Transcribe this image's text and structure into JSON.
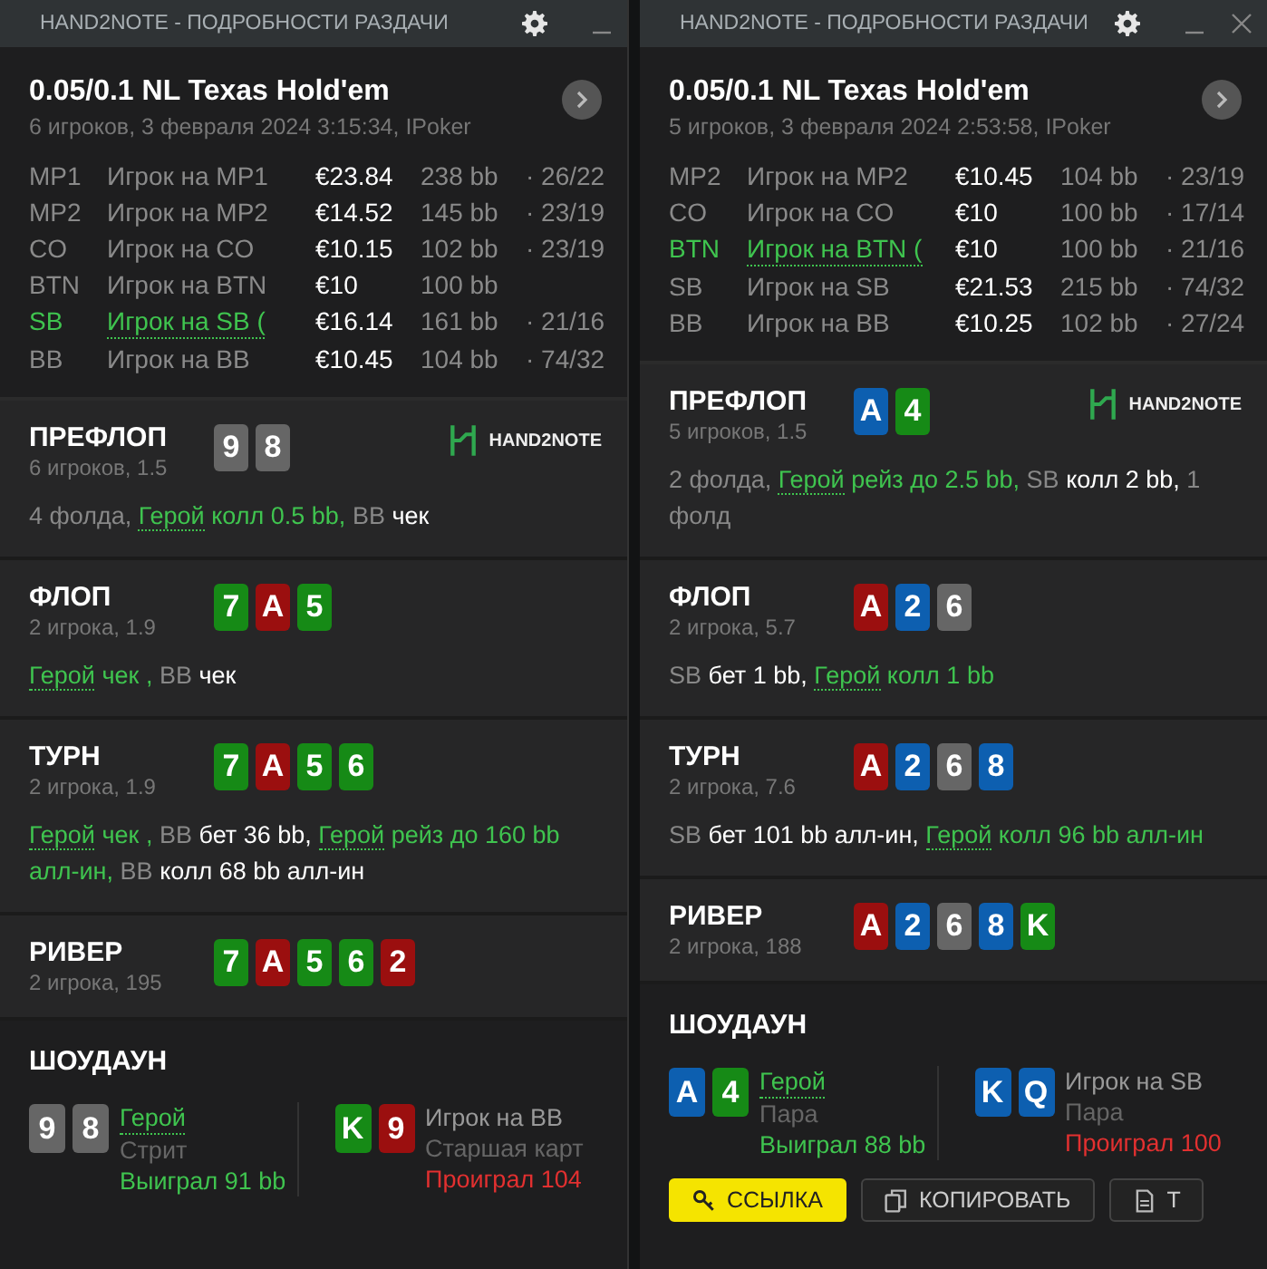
{
  "windows": [
    {
      "title": "HAND2NOTE - ПОДРОБНОСТИ РАЗДАЧИ",
      "close_visible": false,
      "header": {
        "game": "0.05/0.1 NL Texas Hold'em",
        "info": "6 игроков, 3 февраля 2024 3:15:34, IPoker"
      },
      "players": [
        {
          "position": "MP1",
          "name": "Игрок на MP1",
          "stack": "€23.84",
          "bb": "238 bb",
          "stats": "· 26/22",
          "hero": false
        },
        {
          "position": "MP2",
          "name": "Игрок на MP2",
          "stack": "€14.52",
          "bb": "145 bb",
          "stats": "· 23/19",
          "hero": false
        },
        {
          "position": "CO",
          "name": "Игрок на CO",
          "stack": "€10.15",
          "bb": "102 bb",
          "stats": "· 23/19",
          "hero": false
        },
        {
          "position": "BTN",
          "name": "Игрок на BTN",
          "stack": "€10",
          "bb": "100 bb",
          "hero": false
        },
        {
          "position": "SB",
          "name": "Игрок на SB (",
          "stack": "€16.14",
          "bb": "161 bb",
          "stats": "· 21/16",
          "hero": true
        },
        {
          "position": "BB",
          "name": "Игрок на BB",
          "stack": "€10.45",
          "bb": "104 bb",
          "stats": "· 74/32",
          "hero": false
        }
      ],
      "streets": [
        {
          "name": "ПРЕФЛОП",
          "info": "6 игроков, 1.5",
          "logo": "HAND2NOTE",
          "cards": [
            {
              "rank": "9",
              "color": "#666666"
            },
            {
              "rank": "8",
              "color": "#666666"
            }
          ],
          "actions": [
            {
              "text": "4 фолда,",
              "kind": "muted"
            },
            {
              "text": "Герой",
              "kind": "hero"
            },
            {
              "text": "колл 0.5 bb,",
              "kind": "hero_action"
            },
            {
              "text": "BB",
              "kind": "muted"
            },
            {
              "text": "чек",
              "kind": "action"
            }
          ]
        },
        {
          "name": "ФЛОП",
          "info": "2 игрока, 1.9",
          "cards": [
            {
              "rank": "7",
              "color": "#168a16"
            },
            {
              "rank": "A",
              "color": "#9b0f0f"
            },
            {
              "rank": "5",
              "color": "#168a16"
            }
          ],
          "actions": [
            {
              "text": "Герой",
              "kind": "hero"
            },
            {
              "text": "чек ,",
              "kind": "hero_action"
            },
            {
              "text": "BB",
              "kind": "muted"
            },
            {
              "text": "чек",
              "kind": "action"
            }
          ]
        },
        {
          "name": "ТУРН",
          "info": "2 игрока, 1.9",
          "cards": [
            {
              "rank": "7",
              "color": "#168a16"
            },
            {
              "rank": "A",
              "color": "#9b0f0f"
            },
            {
              "rank": "5",
              "color": "#168a16"
            },
            {
              "rank": "6",
              "color": "#168a16"
            }
          ],
          "actions": [
            {
              "text": "Герой",
              "kind": "hero"
            },
            {
              "text": "чек ,",
              "kind": "hero_action"
            },
            {
              "text": "BB",
              "kind": "muted"
            },
            {
              "text": "бет 36 bb,",
              "kind": "action"
            },
            {
              "text": "Герой",
              "kind": "hero"
            },
            {
              "text": "рейз до 160 bb алл-ин,",
              "kind": "hero_action"
            },
            {
              "text": "BB",
              "kind": "muted"
            },
            {
              "text": "колл 68 bb алл-ин",
              "kind": "action"
            }
          ]
        },
        {
          "name": "РИВЕР",
          "info": "2 игрока, 195",
          "cards": [
            {
              "rank": "7",
              "color": "#168a16"
            },
            {
              "rank": "A",
              "color": "#9b0f0f"
            },
            {
              "rank": "5",
              "color": "#168a16"
            },
            {
              "rank": "6",
              "color": "#168a16"
            },
            {
              "rank": "2",
              "color": "#9b0f0f"
            }
          ]
        }
      ],
      "showdown": {
        "title": "ШОУДАУН",
        "hands": [
          {
            "cards": [
              {
                "rank": "9",
                "color": "#666666"
              },
              {
                "rank": "8",
                "color": "#666666"
              }
            ],
            "name": "Герой",
            "hero": true,
            "hand": "Стрит",
            "result": "Выиграл 91 bb",
            "won": true
          },
          {
            "cards": [
              {
                "rank": "K",
                "color": "#168a16"
              },
              {
                "rank": "9",
                "color": "#9b0f0f"
              }
            ],
            "name": "Игрок на BB",
            "hero": false,
            "hand": "Старшая карт",
            "result": "Проиграл 104",
            "won": false
          }
        ]
      }
    },
    {
      "title": "HAND2NOTE - ПОДРОБНОСТИ РАЗДАЧИ",
      "close_visible": true,
      "header": {
        "game": "0.05/0.1 NL Texas Hold'em",
        "info": "5 игроков, 3 февраля 2024 2:53:58, IPoker"
      },
      "players": [
        {
          "position": "MP2",
          "name": "Игрок на MP2",
          "stack": "€10.45",
          "bb": "104 bb",
          "stats": "· 23/19",
          "hero": false
        },
        {
          "position": "CO",
          "name": "Игрок на CO",
          "stack": "€10",
          "bb": "100 bb",
          "stats": "· 17/14",
          "hero": false
        },
        {
          "position": "BTN",
          "name": "Игрок на BTN (",
          "stack": "€10",
          "bb": "100 bb",
          "stats": "· 21/16",
          "hero": true
        },
        {
          "position": "SB",
          "name": "Игрок на SB",
          "stack": "€21.53",
          "bb": "215 bb",
          "stats": "· 74/32",
          "hero": false
        },
        {
          "position": "BB",
          "name": "Игрок на BB",
          "stack": "€10.25",
          "bb": "102 bb",
          "stats": "· 27/24",
          "hero": false
        }
      ],
      "streets": [
        {
          "name": "ПРЕФЛОП",
          "info": "5 игроков, 1.5",
          "logo": "HAND2NOTE",
          "cards": [
            {
              "rank": "A",
              "color": "#0d5fb0"
            },
            {
              "rank": "4",
              "color": "#168a16"
            }
          ],
          "actions": [
            {
              "text": "2 фолда,",
              "kind": "muted"
            },
            {
              "text": "Герой",
              "kind": "hero"
            },
            {
              "text": "рейз до 2.5 bb,",
              "kind": "hero_action"
            },
            {
              "text": "SB",
              "kind": "muted"
            },
            {
              "text": "колл 2 bb,",
              "kind": "action"
            },
            {
              "text": "1 фолд",
              "kind": "muted"
            }
          ]
        },
        {
          "name": "ФЛОП",
          "info": "2 игрока, 5.7",
          "cards": [
            {
              "rank": "A",
              "color": "#9b0f0f"
            },
            {
              "rank": "2",
              "color": "#0d5fb0"
            },
            {
              "rank": "6",
              "color": "#666666"
            }
          ],
          "actions": [
            {
              "text": "SB",
              "kind": "muted"
            },
            {
              "text": "бет 1 bb,",
              "kind": "action"
            },
            {
              "text": "Герой",
              "kind": "hero"
            },
            {
              "text": "колл 1 bb",
              "kind": "hero_action"
            }
          ]
        },
        {
          "name": "ТУРН",
          "info": "2 игрока, 7.6",
          "cards": [
            {
              "rank": "A",
              "color": "#9b0f0f"
            },
            {
              "rank": "2",
              "color": "#0d5fb0"
            },
            {
              "rank": "6",
              "color": "#666666"
            },
            {
              "rank": "8",
              "color": "#0d5fb0"
            }
          ],
          "actions": [
            {
              "text": "SB",
              "kind": "muted"
            },
            {
              "text": "бет 101 bb алл-ин,",
              "kind": "action"
            },
            {
              "text": "Герой",
              "kind": "hero"
            },
            {
              "text": "колл 96 bb алл-ин",
              "kind": "hero_action"
            }
          ]
        },
        {
          "name": "РИВЕР",
          "info": "2 игрока, 188",
          "cards": [
            {
              "rank": "A",
              "color": "#9b0f0f"
            },
            {
              "rank": "2",
              "color": "#0d5fb0"
            },
            {
              "rank": "6",
              "color": "#666666"
            },
            {
              "rank": "8",
              "color": "#0d5fb0"
            },
            {
              "rank": "K",
              "color": "#168a16"
            }
          ]
        }
      ],
      "showdown": {
        "title": "ШОУДАУН",
        "hands": [
          {
            "cards": [
              {
                "rank": "A",
                "color": "#0d5fb0"
              },
              {
                "rank": "4",
                "color": "#168a16"
              }
            ],
            "name": "Герой",
            "hero": true,
            "hand": "Пара",
            "result": "Выиграл 88 bb",
            "won": true
          },
          {
            "cards": [
              {
                "rank": "K",
                "color": "#0d5fb0"
              },
              {
                "rank": "Q",
                "color": "#0d5fb0"
              }
            ],
            "name": "Игрок на SB",
            "hero": false,
            "hand": "Пара",
            "result": "Проиграл 100",
            "won": false
          }
        ]
      },
      "buttons": [
        {
          "label": "ССЫЛКА",
          "kind": "link"
        },
        {
          "label": "КОПИРОВАТЬ",
          "kind": "copy"
        },
        {
          "label": "Т",
          "kind": "text"
        }
      ]
    }
  ]
}
